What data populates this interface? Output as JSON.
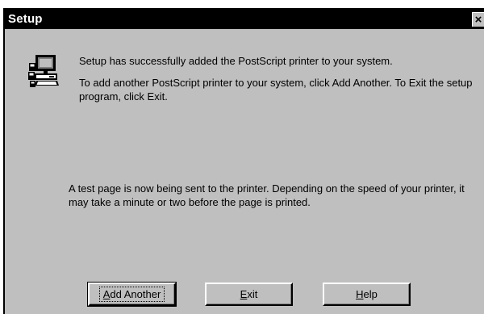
{
  "window": {
    "title": "Setup",
    "close_glyph": "×"
  },
  "messages": {
    "success": "Setup has successfully added the PostScript printer to your system.",
    "add_another_info": "To add another PostScript printer to your system, click Add Another.  To Exit the setup program, click Exit.",
    "test_page": "A test page is now being sent to the printer.  Depending on the speed of your printer, it may take a minute or two before the page is printed."
  },
  "buttons": {
    "add_another": {
      "accel": "A",
      "rest": "dd Another"
    },
    "exit": {
      "accel": "E",
      "rest": "xit"
    },
    "help": {
      "accel": "H",
      "rest": "elp"
    }
  },
  "icons": {
    "setup": "computer-setup-icon",
    "close": "close-icon"
  },
  "colors": {
    "face": "#bfbfbf",
    "titlebar": "#000000",
    "title_text": "#ffffff"
  }
}
